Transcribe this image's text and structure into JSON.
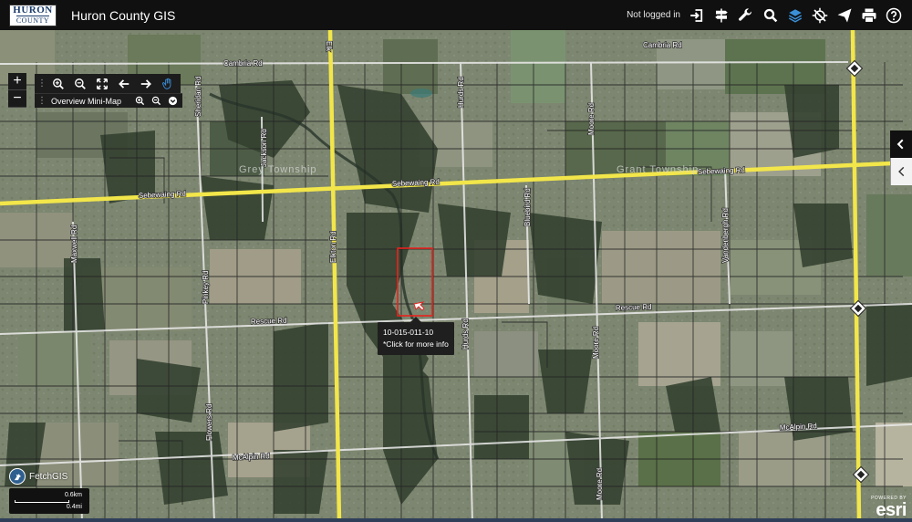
{
  "header": {
    "logo_line1": "HURON",
    "logo_line2": "COUNTY",
    "title": "Huron County GIS",
    "login_status": "Not logged in"
  },
  "toolbar_icons": [
    "login-icon",
    "signpost-icon",
    "wrench-icon",
    "search-icon",
    "layers-icon",
    "gps-off-icon",
    "send-icon",
    "print-icon",
    "help-icon"
  ],
  "colors": {
    "header_bg": "#101010",
    "highway_yellow": "#f2e64a",
    "parcel_line": "#232323",
    "selected_parcel": "#e8231e",
    "layers_active": "#3a8fd8"
  },
  "zoom": {
    "in": "+",
    "out": "−"
  },
  "map_toolbar": {
    "tools": [
      "zoom-in-icon",
      "zoom-out-icon",
      "full-extent-icon",
      "back-arrow-icon",
      "forward-arrow-icon",
      "pan-hand-icon"
    ],
    "overview_label": "Overview Mini-Map"
  },
  "roads": {
    "cambria_1": "Cambria Rd",
    "cambria_2": "Cambria Rd",
    "sebewaing_1": "Sebewaing Rd",
    "sebewaing_2": "Sebewaing Rd",
    "sebewaing_3": "Sebewaing Rd",
    "rescue_1": "Rescue Rd",
    "rescue_2": "Rescue Rd",
    "mcalpin_1": "McAlpin Rd",
    "mcalpin_2": "McAlpin Rd",
    "elkton_1": "Elk",
    "elkton_2": "Elkton Rd",
    "maxwell": "Maxwell Rd",
    "sheridan": "Sheridan Rd",
    "jackson": "Jackson Rd",
    "pinkey": "Pinkey Rd",
    "flowers": "Flowers Rd",
    "hurds_1": "Hurds Rd",
    "hurds_2": "Hurds Rd",
    "bluebird": "Bluebird Rd",
    "moore_1": "Moore Rd",
    "moore_2": "Moore Rd",
    "moore_3": "Moore Rd",
    "vandenbergh": "Vandenbergh Rd"
  },
  "townships": {
    "west": "Grey Township",
    "east": "Grant Township"
  },
  "parcel_tooltip": {
    "parcel_id": "10-015-011-10",
    "hint": "*Click for more info"
  },
  "fetchgis": {
    "label": "FetchGIS"
  },
  "scale": {
    "km": "0.6km",
    "mi": "0.4mi"
  },
  "attribution": {
    "powered": "POWERED BY",
    "brand": "esri"
  }
}
